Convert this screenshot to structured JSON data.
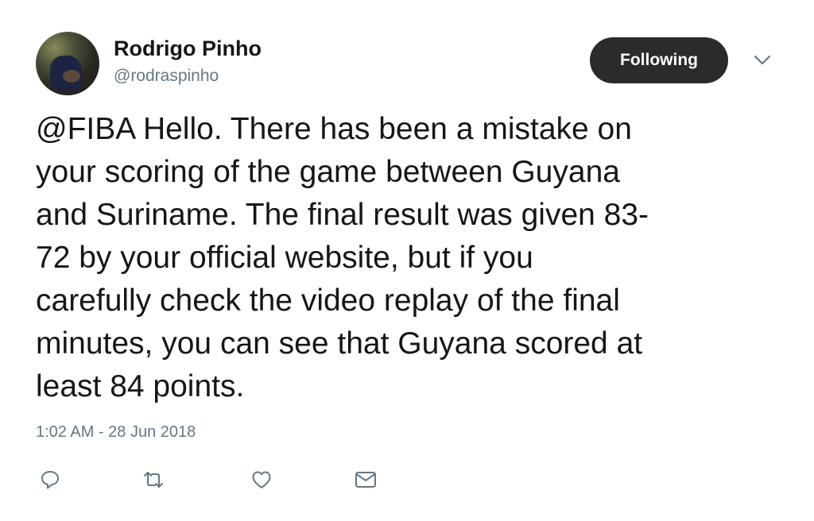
{
  "tweet": {
    "display_name": "Rodrigo Pinho",
    "handle": "@rodraspinho",
    "follow_label": "Following",
    "text": "@FIBA Hello. There has been a mistake on\nyour scoring of the game between Guyana\nand Suriname. The final result was given 83-\n72 by your official website, but if you\ncarefully check the video replay of the final\nminutes, you can see that Guyana scored at\nleast 84 points.",
    "timestamp": "1:02 AM - 28 Jun 2018"
  },
  "icons": {
    "menu": "chevron-down-icon",
    "reply": "reply-icon",
    "retweet": "retweet-icon",
    "like": "heart-icon",
    "message": "envelope-icon"
  },
  "colors": {
    "text_primary": "#14171a",
    "text_secondary": "#657786",
    "button_bg": "#2b2b2b",
    "button_text": "#ffffff"
  }
}
